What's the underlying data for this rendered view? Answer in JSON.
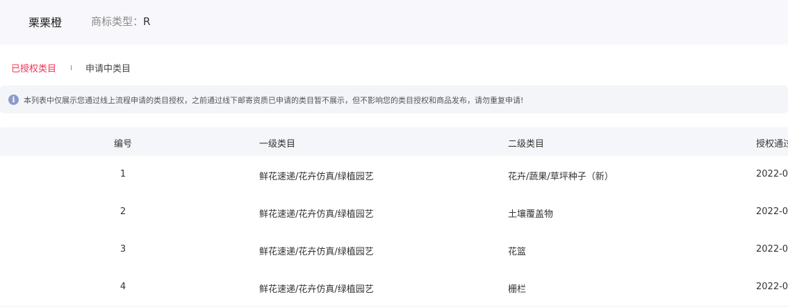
{
  "header": {
    "store_name": "栗栗橙",
    "trademark_label": "商标类型：",
    "trademark_value": "R"
  },
  "tabs": [
    {
      "label": "已授权类目",
      "active": true
    },
    {
      "label": "申请中类目",
      "active": false
    }
  ],
  "notice": {
    "icon": "info-icon",
    "icon_glyph": "i",
    "text": "本列表中仅展示您通过线上流程申请的类目授权，之前通过线下邮寄资质已申请的类目暂不展示，但不影响您的类目授权和商品发布，请勿重复申请!"
  },
  "table": {
    "columns": [
      "编号",
      "一级类目",
      "二级类目",
      "授权通过"
    ],
    "rows": [
      {
        "num": "1",
        "first": "鲜花速递/花卉仿真/绿植园艺",
        "second": "花卉/蔬果/草坪种子（新）",
        "date": "2022-0"
      },
      {
        "num": "2",
        "first": "鲜花速递/花卉仿真/绿植园艺",
        "second": "土壤覆盖物",
        "date": "2022-0"
      },
      {
        "num": "3",
        "first": "鲜花速递/花卉仿真/绿植园艺",
        "second": "花篮",
        "date": "2022-0"
      },
      {
        "num": "4",
        "first": "鲜花速递/花卉仿真/绿植园艺",
        "second": "栅栏",
        "date": "2022-0"
      }
    ]
  },
  "colors": {
    "active_tab": "#ee3355",
    "notice_icon": "#8b9bc9",
    "header_bg": "#f8f8fc"
  }
}
